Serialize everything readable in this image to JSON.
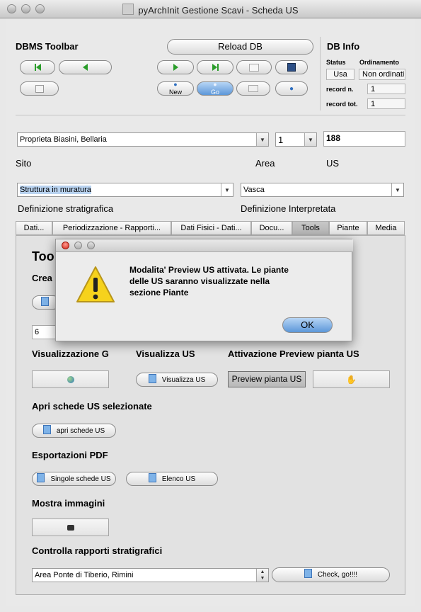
{
  "window": {
    "title": "pyArchInit Gestione Scavi - Scheda US"
  },
  "dbms_toolbar": {
    "title": "DBMS Toolbar",
    "reload_label": "Reload DB",
    "new_label": "New",
    "go_label": "Go"
  },
  "db_info": {
    "title": "DB Info",
    "status_label": "Status",
    "status_value": "Usa",
    "ordinamento_label": "Ordinamento",
    "ordinamento_value": "Non ordinati",
    "record_n_label": "record n.",
    "record_n_value": "1",
    "record_tot_label": "record tot.",
    "record_tot_value": "1"
  },
  "fields": {
    "sito_value": "Proprieta Biasini, Bellaria",
    "sito_label": "Sito",
    "area_value": "1",
    "area_label": "Area",
    "us_value": "188",
    "us_label": "US",
    "def_strat_value": "Struttura in muratura",
    "def_strat_label": "Definizione stratigrafica",
    "def_interp_value": "Vasca",
    "def_interp_label": "Definizione Interpretata"
  },
  "tabs": [
    "Dati...",
    "Periodizzazione - Rapporti...",
    "Dati Fisici - Dati...",
    "Docu...",
    "Tools",
    "Piante",
    "Media"
  ],
  "tools": {
    "heading": "Too",
    "crea_label": "Crea",
    "number_value": "6",
    "vis_g_label": "Visualizzazione G",
    "vis_us_label": "Visualizza US",
    "preview_label": "Attivazione Preview pianta US",
    "vis_us_button": "Visualizza US",
    "preview_button": "Preview pianta US",
    "apri_label": "Apri schede US selezionate",
    "apri_button": "apri schede US",
    "pdf_label": "Esportazioni PDF",
    "singole_button": "Singole schede US",
    "elenco_button": "Elenco US",
    "immagini_label": "Mostra immagini",
    "rapporti_label": "Controlla rapporti stratigrafici",
    "rapporti_value": "Area Ponte di Tiberio, Rimini",
    "check_button": "Check, go!!!!"
  },
  "dialog": {
    "line1": "Modalita' Preview US attivata. Le piante",
    "line2": "delle US saranno visualizzate nella",
    "line3": "sezione Piante",
    "ok_label": "OK"
  }
}
